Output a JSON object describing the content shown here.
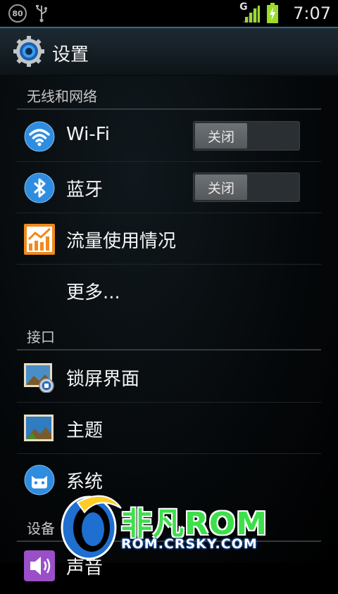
{
  "status_bar": {
    "battery_badge": "80",
    "network_type": "G",
    "time": "7:07",
    "icons": [
      "battery-percent-icon",
      "usb-icon",
      "signal-icon",
      "battery-charging-icon"
    ]
  },
  "action_bar": {
    "title": "设置",
    "icon": "settings-gear-icon"
  },
  "sections": [
    {
      "header": "无线和网络",
      "items": [
        {
          "label": "Wi-Fi",
          "icon": "wifi-icon",
          "toggle": "关闭"
        },
        {
          "label": "蓝牙",
          "icon": "bluetooth-icon",
          "toggle": "关闭"
        },
        {
          "label": "流量使用情况",
          "icon": "data-usage-icon"
        },
        {
          "label": "更多..."
        }
      ]
    },
    {
      "header": "接口",
      "items": [
        {
          "label": "锁屏界面",
          "icon": "lockscreen-icon"
        },
        {
          "label": "主题",
          "icon": "theme-icon"
        },
        {
          "label": "系统",
          "icon": "system-cid-icon"
        }
      ]
    },
    {
      "header": "设备",
      "items": [
        {
          "label": "声音",
          "icon": "sound-icon"
        }
      ]
    }
  ],
  "watermark": {
    "brand": "非凡ROM",
    "url": "ROM.CRSKY.COM"
  },
  "colors": {
    "accent_blue": "#2a6c93",
    "icon_blue": "#2f8de0",
    "data_orange": "#f08a1c",
    "watermark_green": "#3ce04a"
  }
}
